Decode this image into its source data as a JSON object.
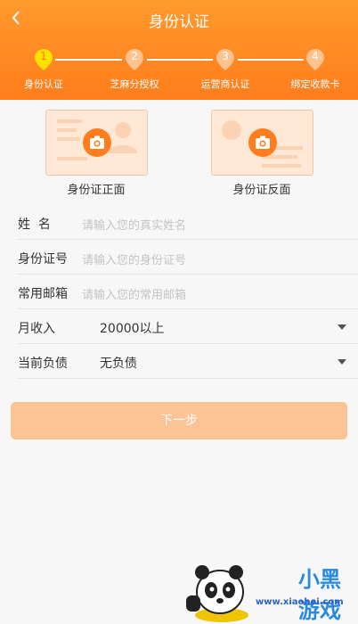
{
  "header": {
    "title": "身份认证"
  },
  "steps": [
    {
      "num": "1",
      "label": "身份认证",
      "active": true
    },
    {
      "num": "2",
      "label": "芝麻分授权",
      "active": false
    },
    {
      "num": "3",
      "label": "运营商认证",
      "active": false
    },
    {
      "num": "4",
      "label": "绑定收款卡",
      "active": false
    }
  ],
  "id_cards": {
    "front_label": "身份证正面",
    "back_label": "身份证反面"
  },
  "form": {
    "name": {
      "label": "姓  名",
      "placeholder": "请输入您的真实姓名"
    },
    "id_number": {
      "label": "身份证号",
      "placeholder": "请输入您的身份证号"
    },
    "email": {
      "label": "常用邮箱",
      "placeholder": "请输入您的常用邮箱"
    },
    "income": {
      "label": "月收入",
      "value": "20000以上"
    },
    "debt": {
      "label": "当前负债",
      "value": "无负债"
    }
  },
  "next_button": "下一步",
  "watermark": {
    "brand": "小黑游戏",
    "url": "www.xiaohei.com"
  },
  "colors": {
    "accent": "#ff7d1c",
    "active_step": "#ffe100",
    "button": "#fcc495"
  }
}
